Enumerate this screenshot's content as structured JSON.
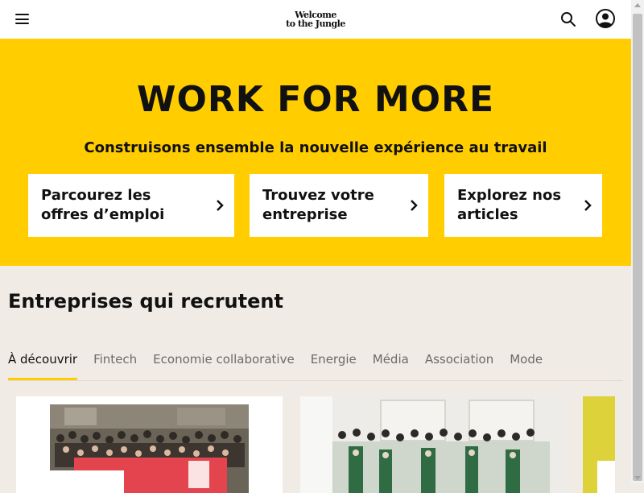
{
  "header": {
    "logo_line1": "Welcome",
    "logo_line2": "to the Jungle",
    "menu_icon": "hamburger-menu-icon",
    "search_icon": "search-icon",
    "user_icon": "user-account-icon"
  },
  "hero": {
    "title": "WORK FOR MORE",
    "subtitle": "Construisons ensemble la nouvelle expérience au travail",
    "background_color": "#ffcd00",
    "cards": [
      {
        "label": "Parcourez les\noffres d’emploi",
        "icon": "chevron-right-icon"
      },
      {
        "label": "Trouvez votre\nentreprise",
        "icon": "chevron-right-icon"
      },
      {
        "label": "Explorez nos\narticles",
        "icon": "chevron-right-icon"
      }
    ]
  },
  "companies": {
    "title": "Entreprises qui recrutent",
    "tabs": [
      {
        "label": "À découvrir",
        "active": true
      },
      {
        "label": "Fintech",
        "active": false
      },
      {
        "label": "Economie collaborative",
        "active": false
      },
      {
        "label": "Energie",
        "active": false
      },
      {
        "label": "Média",
        "active": false
      },
      {
        "label": "Association",
        "active": false
      },
      {
        "label": "Mode",
        "active": false
      }
    ],
    "accent_color": "#ffcd00",
    "cards": [
      {
        "image": "group-photo-b-corp-celebration"
      },
      {
        "image": "team-group-photo-office"
      },
      {
        "image": "yellow-brand-image"
      }
    ]
  }
}
